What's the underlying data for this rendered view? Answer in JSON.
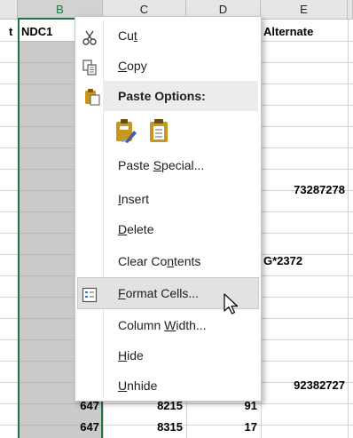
{
  "columns": [
    {
      "letter": "B",
      "selected": true
    },
    {
      "letter": "C",
      "selected": false
    },
    {
      "letter": "D",
      "selected": false
    },
    {
      "letter": "E",
      "selected": false
    }
  ],
  "header_row": {
    "a_partial": "t",
    "b": "NDC1",
    "e": "Alternate"
  },
  "cells": {
    "e_73287278": "73287278",
    "e_g2372": "G*2372",
    "e_92382727": "92382727",
    "row_a": {
      "b": "647",
      "c": "8215",
      "d": "91"
    },
    "row_b": {
      "b": "647",
      "c": "8315",
      "d": "17"
    }
  },
  "menu": {
    "cut": {
      "pre": "Cu",
      "ul": "t",
      "post": ""
    },
    "copy": {
      "pre": "",
      "ul": "C",
      "post": "opy"
    },
    "paste_options": "Paste Options:",
    "paste_special": {
      "pre": "Paste ",
      "ul": "S",
      "post": "pecial..."
    },
    "insert": {
      "pre": "",
      "ul": "I",
      "post": "nsert"
    },
    "delete": {
      "pre": "",
      "ul": "D",
      "post": "elete"
    },
    "clear_contents": {
      "pre": "Clear Co",
      "ul": "n",
      "post": "tents"
    },
    "format_cells": {
      "pre": "",
      "ul": "F",
      "post": "ormat Cells..."
    },
    "column_width": {
      "pre": "Column ",
      "ul": "W",
      "post": "idth..."
    },
    "hide": {
      "pre": "",
      "ul": "H",
      "post": "ide"
    },
    "unhide": {
      "pre": "",
      "ul": "U",
      "post": "nhide"
    }
  },
  "colors": {
    "accent": "#217346",
    "hover": "#e2e2e2",
    "clipboard": "#c9971c"
  }
}
